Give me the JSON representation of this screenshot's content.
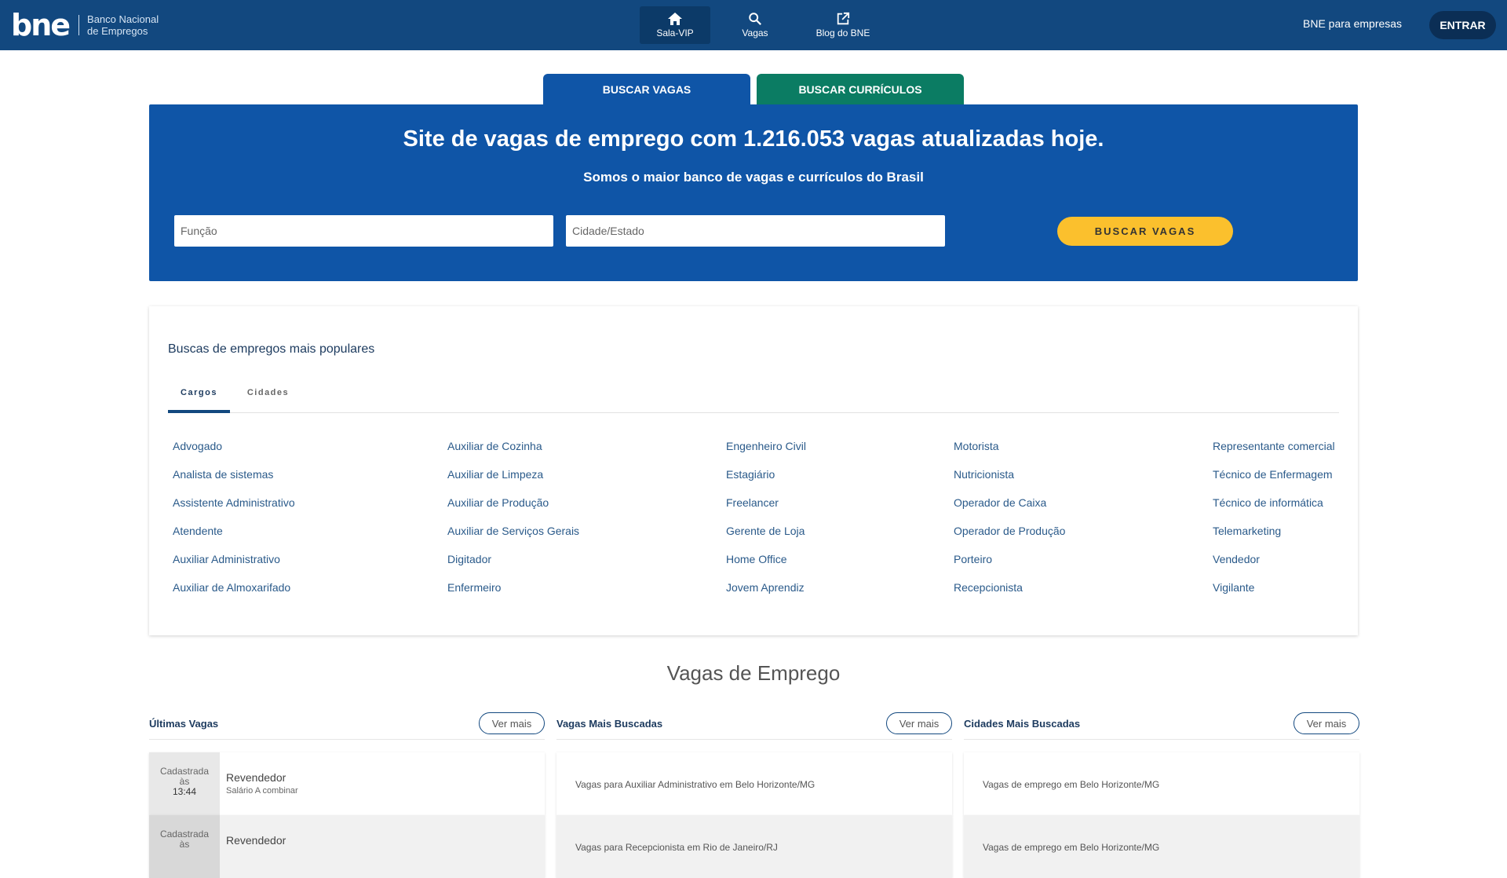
{
  "header": {
    "logo": "bne",
    "logo_sub1": "Banco Nacional",
    "logo_sub2": "de Empregos",
    "nav": [
      {
        "label": "Sala-VIP",
        "icon": "home-icon"
      },
      {
        "label": "Vagas",
        "icon": "search-icon"
      },
      {
        "label": "Blog do BNE",
        "icon": "external-link-icon"
      }
    ],
    "empresas": "BNE para empresas",
    "entrar": "ENTRAR"
  },
  "tabs": {
    "vagas": "BUSCAR VAGAS",
    "curriculos": "BUSCAR CURRÍCULOS"
  },
  "hero": {
    "title": "Site de vagas de emprego com 1.216.053 vagas atualizadas hoje.",
    "subtitle": "Somos o maior banco de vagas e currículos do Brasil",
    "funcao_placeholder": "Função",
    "cidade_placeholder": "Cidade/Estado",
    "buscar": "BUSCAR VAGAS"
  },
  "popular": {
    "title": "Buscas de empregos mais populares",
    "tab_cargos": "Cargos",
    "tab_cidades": "Cidades",
    "columns": [
      [
        "Advogado",
        "Analista de sistemas",
        "Assistente Administrativo",
        "Atendente",
        "Auxiliar Administrativo",
        "Auxiliar de Almoxarifado"
      ],
      [
        "Auxiliar de Cozinha",
        "Auxiliar de Limpeza",
        "Auxiliar de Produção",
        "Auxiliar de Serviços Gerais",
        "Digitador",
        "Enfermeiro"
      ],
      [
        "Engenheiro Civil",
        "Estagiário",
        "Freelancer",
        "Gerente de Loja",
        "Home Office",
        "Jovem Aprendiz"
      ],
      [
        "Motorista",
        "Nutricionista",
        "Operador de Caixa",
        "Operador de Produção",
        "Porteiro",
        "Recepcionista"
      ],
      [
        "Representante comercial",
        "Técnico de Enfermagem",
        "Técnico de informática",
        "Telemarketing",
        "Vendedor",
        "Vigilante"
      ]
    ]
  },
  "vagas": {
    "title": "Vagas de Emprego",
    "ultimas": {
      "title": "Últimas Vagas",
      "ver_mais": "Ver mais",
      "items": [
        {
          "cad1": "Cadastrada",
          "cad2": "às",
          "time": "13:44",
          "title": "Revendedor",
          "salary": "Salário A combinar"
        },
        {
          "cad1": "Cadastrada",
          "cad2": "às",
          "time": "",
          "title": "Revendedor",
          "salary": ""
        }
      ]
    },
    "mais_buscadas": {
      "title": "Vagas Mais Buscadas",
      "ver_mais": "Ver mais",
      "items": [
        "Vagas para Auxiliar Administrativo em Belo Horizonte/MG",
        "Vagas para Recepcionista em Rio de Janeiro/RJ"
      ]
    },
    "cidades": {
      "title": "Cidades Mais Buscadas",
      "ver_mais": "Ver mais",
      "items": [
        "Vagas de emprego em Belo Horizonte/MG",
        "Vagas de emprego em Belo Horizonte/MG"
      ]
    }
  }
}
